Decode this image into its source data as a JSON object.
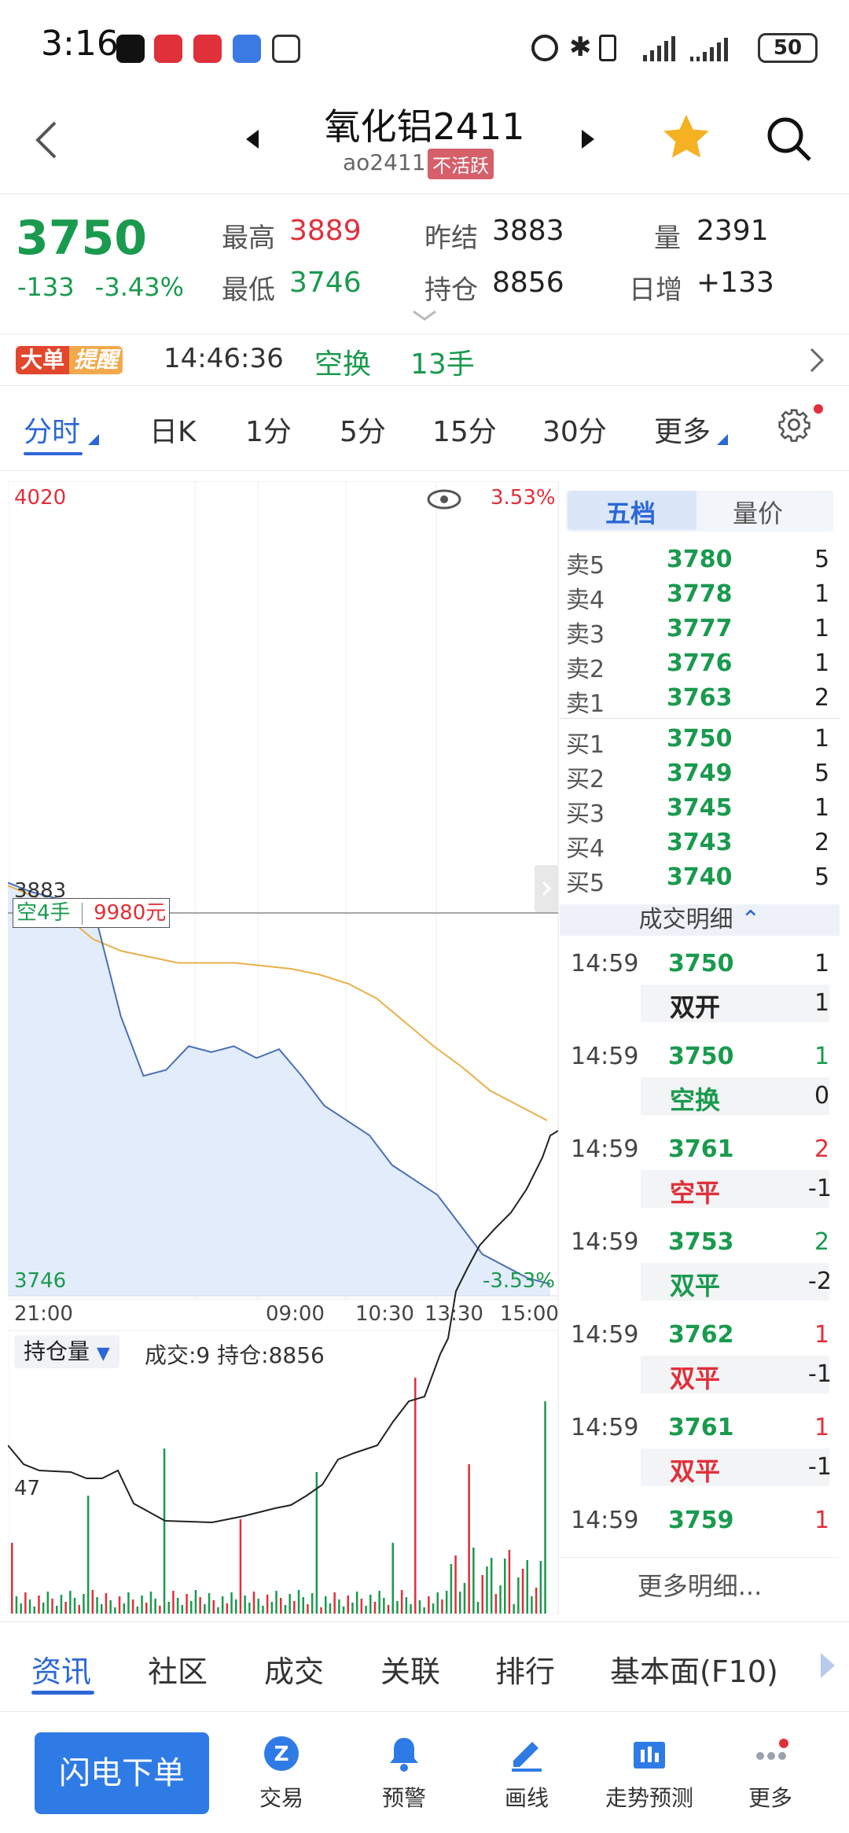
{
  "status": {
    "time": "3:16",
    "battery": "50"
  },
  "header": {
    "title": "氧化铝2411",
    "code": "ao2411",
    "badge": "不活跃"
  },
  "quote": {
    "price": "3750",
    "change": "-133",
    "change_pct": "-3.43%",
    "high_label": "最高",
    "high": "3889",
    "low_label": "最低",
    "low": "3746",
    "prev_label": "昨结",
    "prev": "3883",
    "oi_label": "持仓",
    "oi": "8856",
    "vol_label": "量",
    "vol": "2391",
    "daily_label": "日增",
    "daily": "+133"
  },
  "alert": {
    "badge1": "大单",
    "badge2": "提醒",
    "time": "14:46:36",
    "type": "空换",
    "qty": "13手"
  },
  "tabs": [
    "分时",
    "日K",
    "1分",
    "5分",
    "15分",
    "30分",
    "更多"
  ],
  "chart": {
    "top_price": "4020",
    "top_pct": "3.53%",
    "ref_price": "3883",
    "bottom_price": "3746",
    "bottom_pct": "-3.53%",
    "marker_left": "空4手",
    "marker_right": "9980元",
    "time_labels": [
      "21:00",
      "09:00",
      "10:30",
      "13:30",
      "15:00"
    ],
    "sub_selector": "持仓量",
    "sub_info": "成交:9 持仓:8856",
    "sub_level": "47"
  },
  "chart_data": {
    "type": "line",
    "title": "",
    "ylim": [
      3746,
      4020
    ],
    "series": [
      {
        "name": "",
        "values": [
          3885,
          3882,
          3880,
          3878,
          3870,
          3840,
          3820,
          3822,
          3830,
          3828,
          3830,
          3826,
          3829,
          3820,
          3810,
          3805,
          3800,
          3790,
          3785,
          3780,
          3770,
          3760,
          3756,
          3752,
          3750
        ]
      },
      {
        "name": "",
        "values": [
          3884,
          3880,
          3874,
          3866,
          3862,
          3860,
          3858,
          3858,
          3858,
          3857,
          3856,
          3854,
          3851,
          3846,
          3838,
          3830,
          3823,
          3815,
          3810,
          3805
        ]
      }
    ]
  },
  "orderbook": {
    "tab_active": "五档",
    "tab_other": "量价",
    "asks": [
      {
        "label": "卖5",
        "price": "3780",
        "qty": "5"
      },
      {
        "label": "卖4",
        "price": "3778",
        "qty": "1"
      },
      {
        "label": "卖3",
        "price": "3777",
        "qty": "1"
      },
      {
        "label": "卖2",
        "price": "3776",
        "qty": "1"
      },
      {
        "label": "卖1",
        "price": "3763",
        "qty": "2"
      }
    ],
    "bids": [
      {
        "label": "买1",
        "price": "3750",
        "qty": "1"
      },
      {
        "label": "买2",
        "price": "3749",
        "qty": "5"
      },
      {
        "label": "买3",
        "price": "3745",
        "qty": "1"
      },
      {
        "label": "买4",
        "price": "3743",
        "qty": "2"
      },
      {
        "label": "买5",
        "price": "3740",
        "qty": "5"
      }
    ]
  },
  "trades": {
    "header": "成交明细",
    "items": [
      {
        "time": "14:59",
        "price": "3750",
        "qty": "1",
        "qty_color": "#222222",
        "type": "双开",
        "type_color": "#222222",
        "chg": "1"
      },
      {
        "time": "14:59",
        "price": "3750",
        "qty": "1",
        "qty_color": "#1a9a4e",
        "type": "空换",
        "type_color": "#1a9a4e",
        "chg": "0"
      },
      {
        "time": "14:59",
        "price": "3761",
        "qty": "2",
        "qty_color": "#e0303a",
        "type": "空平",
        "type_color": "#e0303a",
        "chg": "-1"
      },
      {
        "time": "14:59",
        "price": "3753",
        "qty": "2",
        "qty_color": "#1a9a4e",
        "type": "双平",
        "type_color": "#1a9a4e",
        "chg": "-2"
      },
      {
        "time": "14:59",
        "price": "3762",
        "qty": "1",
        "qty_color": "#e0303a",
        "type": "双平",
        "type_color": "#e0303a",
        "chg": "-1"
      },
      {
        "time": "14:59",
        "price": "3761",
        "qty": "1",
        "qty_color": "#e0303a",
        "type": "双平",
        "type_color": "#e0303a",
        "chg": "-1"
      },
      {
        "time": "14:59",
        "price": "3759",
        "qty": "1",
        "qty_color": "#e0303a",
        "type": "",
        "type_color": "#e0303a",
        "chg": ""
      }
    ],
    "more": "更多明细..."
  },
  "bottom_tabs": [
    "资讯",
    "社区",
    "成交",
    "关联",
    "排行",
    "基本面(F10)"
  ],
  "nav": {
    "flash": "闪电下单",
    "items": [
      "交易",
      "预警",
      "画线",
      "走势预测",
      "更多"
    ]
  }
}
